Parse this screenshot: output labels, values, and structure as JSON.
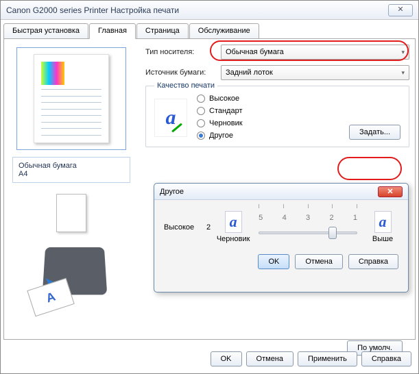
{
  "window": {
    "title": "Canon G2000 series Printer Настройка печати",
    "close_glyph": "✕"
  },
  "tabs": {
    "quick": "Быстрая установка",
    "main": "Главная",
    "page": "Страница",
    "service": "Обслуживание"
  },
  "preview": {
    "media": "Обычная бумага",
    "size": "A4"
  },
  "fields": {
    "media_label": "Тип носителя:",
    "media_value": "Обычная бумага",
    "source_label": "Источник бумаги:",
    "source_value": "Задний лоток"
  },
  "quality": {
    "group_title": "Качество печати",
    "icon_glyph": "a",
    "options": {
      "high": "Высокое",
      "standard": "Стандарт",
      "draft": "Черновик",
      "other": "Другое"
    },
    "selected": "other",
    "set_btn": "Задать..."
  },
  "dialog": {
    "title": "Другое",
    "left_label": "Высокое",
    "value": "2",
    "marks": [
      "5",
      "4",
      "3",
      "2",
      "1"
    ],
    "bottom_left": "Черновик",
    "bottom_right": "Выше",
    "glyph": "a",
    "ok": "OK",
    "cancel": "Отмена",
    "help": "Справка",
    "thumb_index": 3
  },
  "defaults_btn": "По умолч.",
  "footer": {
    "ok": "OK",
    "cancel": "Отмена",
    "apply": "Применить",
    "help": "Справка"
  },
  "printer_paper_glyph": "A"
}
